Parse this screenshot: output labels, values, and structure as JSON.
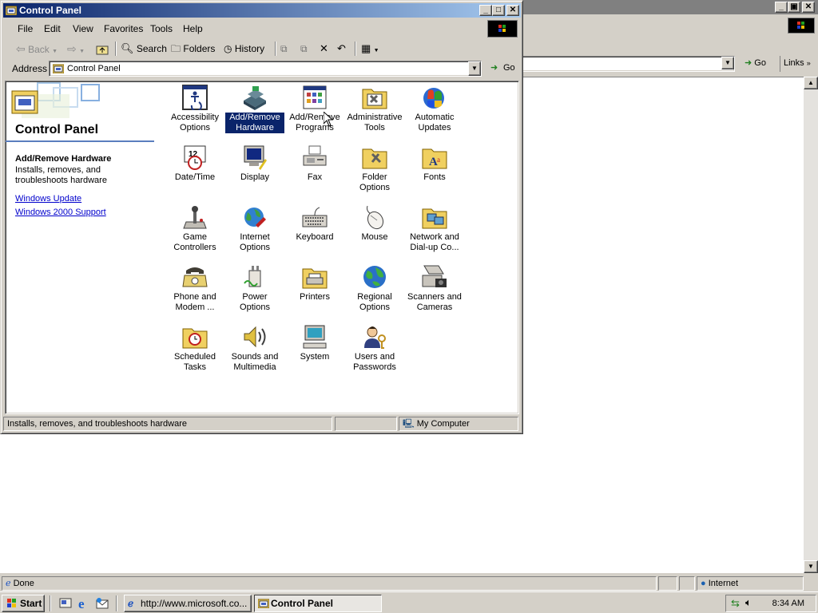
{
  "background_window": {
    "address_go_label": "Go",
    "links_label": "Links",
    "status": {
      "text": "Done",
      "zone": "Internet"
    }
  },
  "control_panel": {
    "title": "Control Panel",
    "menu": [
      "File",
      "Edit",
      "View",
      "Favorites",
      "Tools",
      "Help"
    ],
    "toolbar": {
      "back": "Back",
      "search": "Search",
      "folders": "Folders",
      "history": "History"
    },
    "address": {
      "label": "Address",
      "value": "Control Panel",
      "go": "Go"
    },
    "left_pane": {
      "heading": "Control Panel",
      "selected_name": "Add/Remove Hardware",
      "selected_description": "Installs, removes, and troubleshoots hardware",
      "links": [
        "Windows Update",
        "Windows 2000 Support"
      ]
    },
    "icons": [
      {
        "label": "Accessibility Options",
        "icon": "accessibility-icon"
      },
      {
        "label": "Add/Remove Hardware",
        "icon": "add-remove-hardware-icon",
        "selected": true
      },
      {
        "label": "Add/Remove Programs",
        "icon": "add-remove-programs-icon"
      },
      {
        "label": "Administrative Tools",
        "icon": "administrative-tools-icon"
      },
      {
        "label": "Automatic Updates",
        "icon": "automatic-updates-icon"
      },
      {
        "label": "Date/Time",
        "icon": "date-time-icon"
      },
      {
        "label": "Display",
        "icon": "display-icon"
      },
      {
        "label": "Fax",
        "icon": "fax-icon"
      },
      {
        "label": "Folder Options",
        "icon": "folder-options-icon"
      },
      {
        "label": "Fonts",
        "icon": "fonts-icon"
      },
      {
        "label": "Game Controllers",
        "icon": "game-controllers-icon"
      },
      {
        "label": "Internet Options",
        "icon": "internet-options-icon"
      },
      {
        "label": "Keyboard",
        "icon": "keyboard-icon"
      },
      {
        "label": "Mouse",
        "icon": "mouse-icon"
      },
      {
        "label": "Network and Dial-up Co...",
        "icon": "network-dialup-icon"
      },
      {
        "label": "Phone and Modem ...",
        "icon": "phone-modem-icon"
      },
      {
        "label": "Power Options",
        "icon": "power-options-icon"
      },
      {
        "label": "Printers",
        "icon": "printers-icon"
      },
      {
        "label": "Regional Options",
        "icon": "regional-options-icon"
      },
      {
        "label": "Scanners and Cameras",
        "icon": "scanners-cameras-icon"
      },
      {
        "label": "Scheduled Tasks",
        "icon": "scheduled-tasks-icon"
      },
      {
        "label": "Sounds and Multimedia",
        "icon": "sounds-multimedia-icon"
      },
      {
        "label": "System",
        "icon": "system-icon"
      },
      {
        "label": "Users and Passwords",
        "icon": "users-passwords-icon"
      }
    ],
    "status": {
      "text": "Installs, removes, and troubleshoots hardware",
      "zone": "My Computer"
    }
  },
  "taskbar": {
    "start": "Start",
    "tasks": [
      {
        "label": "http://www.microsoft.co...",
        "active": false
      },
      {
        "label": "Control Panel",
        "active": true
      }
    ],
    "clock": "8:34 AM"
  },
  "colors": {
    "titlebar_active_start": "#0a246a",
    "titlebar_active_end": "#a6caf0",
    "titlebar_inactive": "#808080",
    "face": "#d4d0c8",
    "selection": "#0a246a",
    "link": "#0000cc"
  }
}
